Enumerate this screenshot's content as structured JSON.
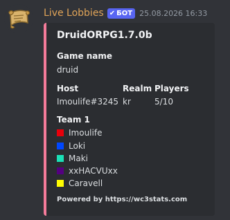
{
  "message": {
    "author": "Live Lobbies",
    "bot_tag": "БОТ",
    "bot_check_icon": "checkmark-icon",
    "timestamp": "25.08.2026 16:33",
    "avatar_icon": "scroll-icon"
  },
  "embed": {
    "accent_color": "#f47b9a",
    "title": "DruidORPG1.7.0b",
    "game_name_label": "Game name",
    "game_name_value": "druid",
    "host_label": "Host",
    "host_value": "Imoulife#3245",
    "realm_label": "Realm",
    "realm_value": "kr",
    "players_label": "Players",
    "players_value": "5/10",
    "team_label": "Team 1",
    "team_members": [
      {
        "name": "Imoulife",
        "color": "#e8000b"
      },
      {
        "name": "Loki",
        "color": "#0047ff"
      },
      {
        "name": "Maki",
        "color": "#1be0b6"
      },
      {
        "name": "xxHACVUxx",
        "color": "#540081"
      },
      {
        "name": "Caravell",
        "color": "#fffc01"
      }
    ],
    "footer": "Powered by https://wc3stats.com"
  }
}
